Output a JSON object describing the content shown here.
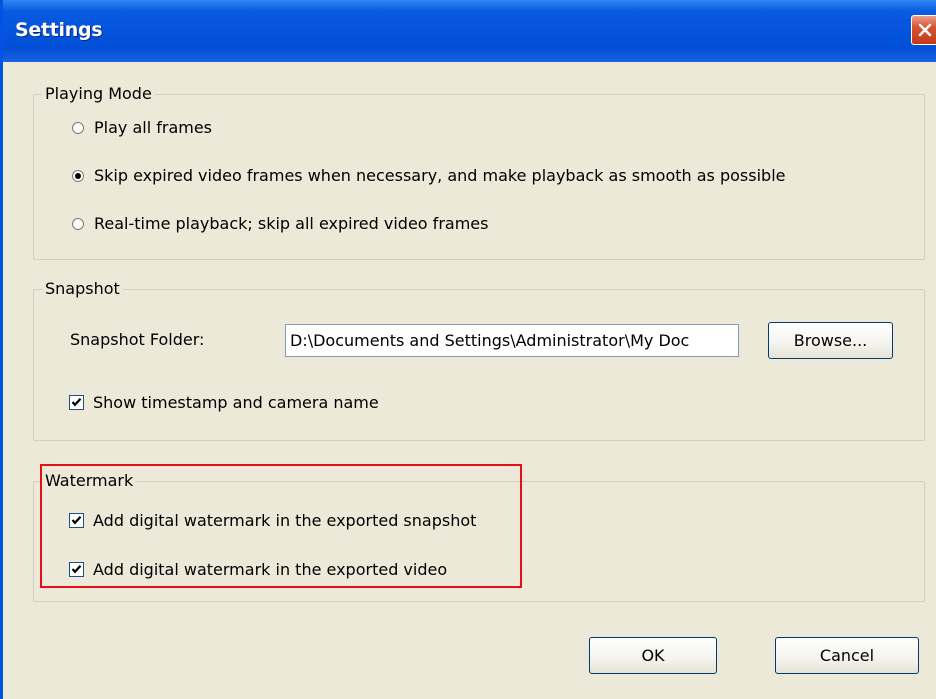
{
  "window": {
    "title": "Settings"
  },
  "playing_mode": {
    "legend": "Playing Mode",
    "options": [
      {
        "label": "Play all frames",
        "checked": false
      },
      {
        "label": "Skip expired video frames when necessary, and make playback as smooth as possible",
        "checked": true
      },
      {
        "label": "Real-time playback; skip all expired video frames",
        "checked": false
      }
    ]
  },
  "snapshot": {
    "legend": "Snapshot",
    "folder_label": "Snapshot Folder:",
    "folder_value": "D:\\Documents and Settings\\Administrator\\My Doc",
    "browse_label": "Browse...",
    "timestamp_label": "Show timestamp and camera name",
    "timestamp_checked": true
  },
  "watermark": {
    "legend": "Watermark",
    "options": [
      {
        "label": "Add digital watermark in the exported snapshot",
        "checked": true
      },
      {
        "label": "Add digital watermark in the exported video",
        "checked": true
      }
    ]
  },
  "footer": {
    "ok_label": "OK",
    "cancel_label": "Cancel"
  },
  "colors": {
    "titlebar": "#0453DD",
    "dialog_bg": "#ECE9D8",
    "highlight_box": "#E3101A"
  }
}
